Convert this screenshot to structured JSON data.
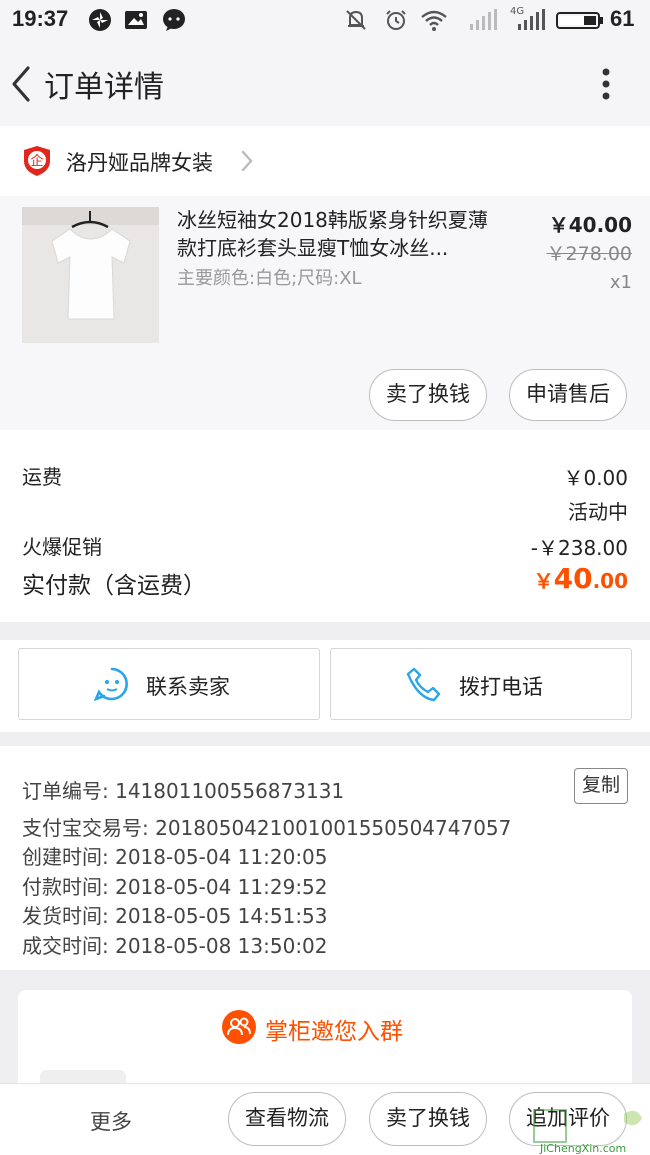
{
  "status_bar": {
    "time": "19:37",
    "battery": "61",
    "network": "4G",
    "icons": [
      "pinwheel-icon",
      "image-icon",
      "chat-icon",
      "mute-icon",
      "alarm-icon",
      "wifi-icon",
      "signal-icon",
      "signal-4g-icon",
      "battery-icon"
    ]
  },
  "header": {
    "title": "订单详情",
    "back_icon": "chevron-left-icon",
    "more_icon": "more-vertical-icon"
  },
  "shop": {
    "name": "洛丹娅品牌女装",
    "logo_text": "企"
  },
  "item": {
    "title": "冰丝短袖女2018韩版紧身针织夏薄款打底衫套头显瘦T恤女冰丝...",
    "sku": "主要颜色:白色;尺码:XL",
    "price": "￥40.00",
    "original_price": "￥278.00",
    "quantity": "x1",
    "actions": [
      "卖了换钱",
      "申请售后"
    ]
  },
  "costs": {
    "shipping_label": "运费",
    "shipping_value": "￥0.00",
    "promo_status": "活动中",
    "promo_label": "火爆促销",
    "promo_value": "-￥238.00",
    "total_label": "实付款（含运费）",
    "total_currency": "￥",
    "total_int": "40",
    "total_cents": ".00"
  },
  "contact": {
    "seller_label": "联系卖家",
    "call_label": "拨打电话"
  },
  "order_info": {
    "copy_label": "复制",
    "lines": [
      "订单编号: 1418011005568731​31",
      "支付宝交易号: 2018050421001001550504747057",
      "创建时间: 2018-05-04 11:20:05",
      "付款时间: 2018-05-04 11:29:52",
      "发货时间: 2018-05-05 14:51:53",
      "成交时间: 2018-05-08 13:50:02"
    ]
  },
  "group": {
    "text": "掌柜邀您入群"
  },
  "bottom_bar": {
    "more": "更多",
    "logistics": "查看物流",
    "sell": "卖了换钱",
    "review": "追加评价"
  },
  "colors": {
    "accent": "#ff5000",
    "icon_blue": "#2aa6e8",
    "shop_logo": "#e2261c"
  }
}
